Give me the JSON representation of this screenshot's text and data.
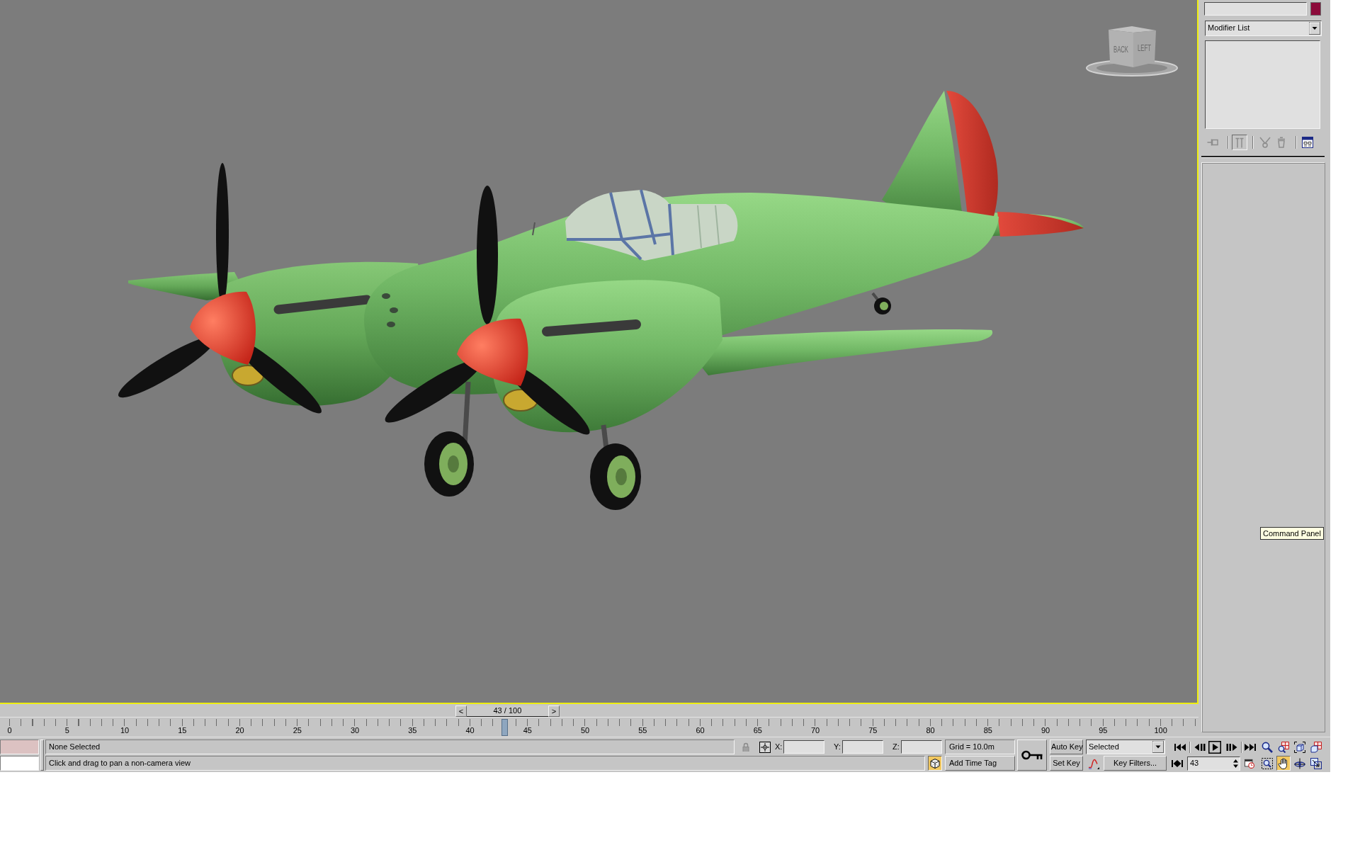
{
  "viewport": {
    "active": true,
    "viewcube": {
      "faces": [
        "BACK",
        "LEFT"
      ]
    }
  },
  "command_panel": {
    "modifier_list": "Modifier List",
    "stack_tools": [
      {
        "kind": "pin",
        "pressed": false,
        "disabled": true
      },
      {
        "kind": "end-result",
        "pressed": true,
        "disabled": true
      },
      {
        "kind": "make-unique",
        "pressed": false,
        "disabled": true
      },
      {
        "kind": "remove",
        "pressed": false,
        "disabled": true
      },
      {
        "kind": "configure",
        "pressed": false,
        "disabled": false
      }
    ]
  },
  "tooltip": "Command Panel",
  "time_slider": {
    "prev": "<",
    "label": "43 / 100",
    "next": ">"
  },
  "track_bar": {
    "ticks": [
      "0",
      "5",
      "10",
      "15",
      "20",
      "25",
      "30",
      "35",
      "40",
      "45",
      "50",
      "55",
      "60",
      "65",
      "70",
      "75",
      "80",
      "85",
      "90",
      "95",
      "100"
    ],
    "level": 0.43
  },
  "status_bar": {
    "selection": "None Selected",
    "prompt": "Click and drag to pan a non-camera view",
    "axes": [
      "X:",
      "Y:",
      "Z:"
    ],
    "grid": "Grid = 10.0m",
    "cube_toggle": {
      "on": true
    },
    "time_tag": "Add Time Tag"
  },
  "keying": {
    "auto_key": "Auto Key",
    "set_key": "Set Key",
    "key_mode": "Selected",
    "key_filters": "Key Filters..."
  },
  "playback": {
    "controls": [
      {
        "kind": "start"
      },
      {
        "kind": "prev"
      },
      {
        "kind": "play"
      },
      {
        "kind": "next"
      },
      {
        "kind": "end"
      }
    ],
    "frame": "43"
  },
  "nav_tools": [
    {
      "kind": "zoom",
      "on": false
    },
    {
      "kind": "zoom-all",
      "on": false
    },
    {
      "kind": "zoom-extents",
      "on": false
    },
    {
      "kind": "zoom-extents-all",
      "on": false
    },
    {
      "kind": "zoom-region",
      "on": false
    },
    {
      "kind": "pan",
      "on": true
    },
    {
      "kind": "orbit",
      "on": false
    },
    {
      "kind": "maximize",
      "on": false
    }
  ]
}
